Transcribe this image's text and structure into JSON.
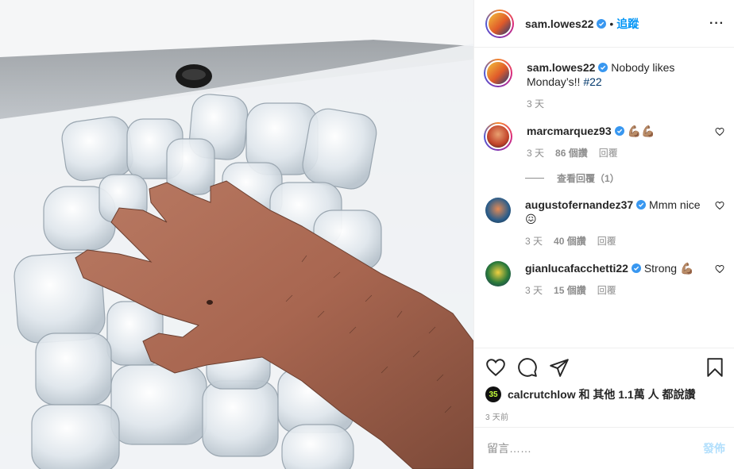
{
  "post": {
    "author": "sam.lowes22",
    "follow_label": "追蹤",
    "caption_text": "Nobody likes Monday’s!!",
    "caption_hashtag": "#22",
    "caption_time": "3 天"
  },
  "comments": [
    {
      "user": "marcmarquez93",
      "text": "💪🏽💪🏽",
      "time": "3 天",
      "likes": "86 個讚",
      "reply": "回覆",
      "view_replies": "查看回覆（1）"
    },
    {
      "user": "augustofernandez37",
      "text": "Mmm nice 😖",
      "time": "3 天",
      "likes": "40 個讚",
      "reply": "回覆"
    },
    {
      "user": "gianlucafacchetti22",
      "text": "Strong 💪🏽",
      "time": "3 天",
      "likes": "15 個讚",
      "reply": "回覆"
    }
  ],
  "likes_summary": {
    "avatar_text": "35",
    "text": "calcrutchlow 和 其他 1.1萬 人 都說讚"
  },
  "posted_ago": "3 天前",
  "comment_box": {
    "placeholder": "留言……",
    "post_label": "發佈"
  },
  "icons": [
    "heart-icon",
    "comment-icon",
    "share-icon",
    "bookmark-icon",
    "more-icon",
    "verified-badge-icon"
  ],
  "colors": {
    "accent_blue": "#0095f6",
    "post_button_disabled": "#b2dffc",
    "muted_text": "#8e8e8e",
    "verified": "#3897f0"
  }
}
